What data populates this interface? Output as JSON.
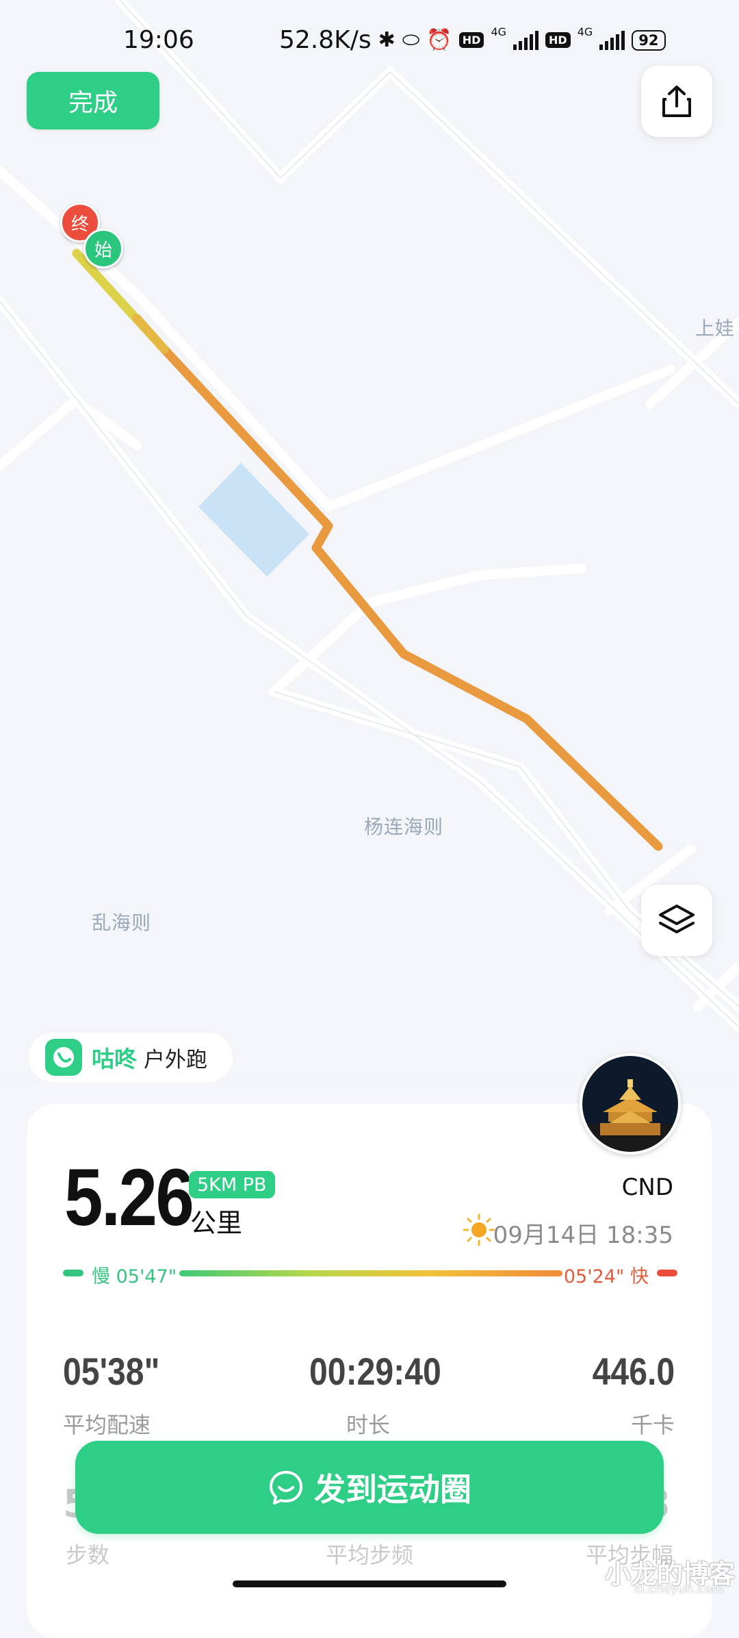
{
  "status_bar": {
    "time": "19:06",
    "speed": "52.8K/s",
    "network_1": "4G",
    "network_2": "4G",
    "hd_1": "HD",
    "hd_2": "HD",
    "battery": "92"
  },
  "header": {
    "done_label": "完成",
    "share_icon": "share-icon"
  },
  "map": {
    "pin_end": "终",
    "pin_start": "始",
    "label_1": "上娃",
    "label_2": "杨连海则",
    "label_3": "乱海则",
    "layers_icon": "layers-icon",
    "route_colors": [
      "#dcd24a",
      "#e99a3e",
      "#e8823a"
    ]
  },
  "brand": {
    "name": "咕咚",
    "type": "户外跑",
    "logo_icon": "codoon-logo-icon"
  },
  "summary": {
    "distance": "5.26",
    "unit": "公里",
    "badge": "5KM PB",
    "user_name": "CND",
    "datetime": "09月14日 18:35",
    "weather_icon": "sun-icon",
    "pace_slow": "慢 05'47\"",
    "pace_fast": "05'24\" 快"
  },
  "stats": [
    {
      "value": "05'38\"",
      "label": "平均配速"
    },
    {
      "value": "00:29:40",
      "label": "时长"
    },
    {
      "value": "446.0",
      "label": "千卡"
    }
  ],
  "stats_row2_partial": {
    "left_value": "5",
    "right_value": "8",
    "labels": [
      "步数",
      "平均步频",
      "平均步幅"
    ]
  },
  "cta": {
    "label": "发到运动圈"
  },
  "watermark": {
    "main": "小龙的博客",
    "sub": "xl.cndyun.com"
  },
  "colors": {
    "accent": "#2fce86",
    "slow": "#34c47f",
    "fast": "#e25b3a"
  }
}
